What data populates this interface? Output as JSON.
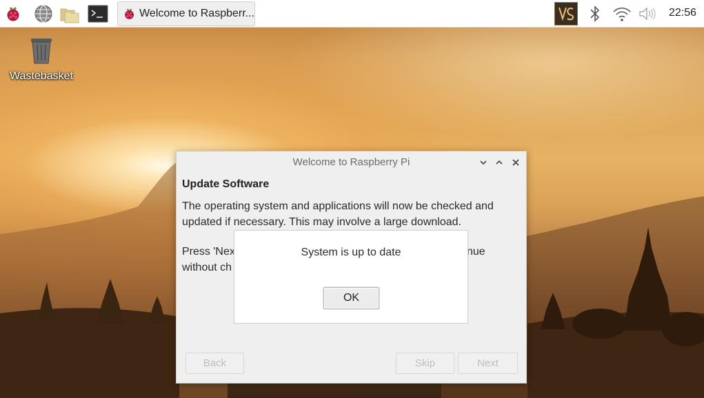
{
  "taskbar": {
    "menu_icon": "raspberry-icon",
    "launchers": [
      "web-browser-icon",
      "file-manager-icon",
      "terminal-icon"
    ],
    "task_button": {
      "icon": "raspberry-icon",
      "label": "Welcome to Raspberr..."
    },
    "tray": [
      "vnc-icon",
      "bluetooth-icon",
      "wifi-icon",
      "volume-icon"
    ],
    "clock": "22:56"
  },
  "desktop": {
    "icons": [
      {
        "label": "Wastebasket",
        "icon": "trash-icon"
      }
    ]
  },
  "window": {
    "title": "Welcome to Raspberry Pi",
    "controls": [
      "minimize-icon",
      "maximize-icon",
      "close-icon"
    ],
    "heading": "Update Software",
    "paragraph1": "The operating system and applications will now be checked and updated if necessary. This may involve a large download.",
    "paragraph2_left_line1": "Press 'Next",
    "paragraph2_right_line1": "nue",
    "paragraph2_line2": "without ch",
    "buttons": {
      "back": "Back",
      "skip": "Skip",
      "next": "Next"
    }
  },
  "dialog": {
    "message": "System is up to date",
    "ok_label": "OK"
  },
  "colors": {
    "panel_bg": "#ffffff",
    "window_bg": "#efefef",
    "dialog_bg": "#ffffff",
    "disabled_text": "#bdbdbd"
  }
}
